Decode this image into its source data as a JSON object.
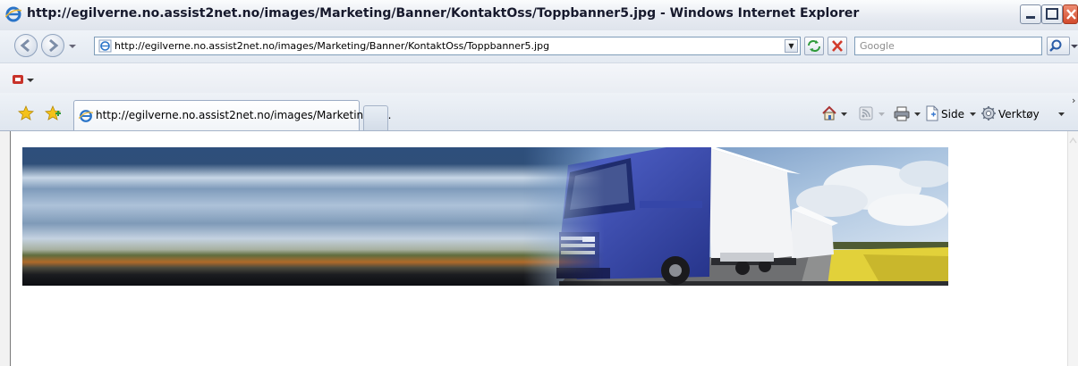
{
  "window": {
    "title": "http://egilverne.no.assist2net.no/images/Marketing/Banner/KontaktOss/Toppbanner5.jpg - Windows Internet Explorer"
  },
  "address_bar": {
    "url": "http://egilverne.no.assist2net.no/images/Marketing/Banner/KontaktOss/Toppbanner5.jpg"
  },
  "search": {
    "placeholder": "Google"
  },
  "tabs": [
    {
      "label": "http://egilverne.no.assist2net.no/images/Marketing/B..."
    }
  ],
  "command_bar": {
    "page_label": "Side",
    "tools_label": "Verktøy"
  },
  "content": {
    "image": "truck-banner",
    "colors": {
      "truck": "#3c4fb5",
      "trailer": "#f2f3f5",
      "field": "#e2d13a",
      "sky": "#b8cbe0"
    }
  }
}
